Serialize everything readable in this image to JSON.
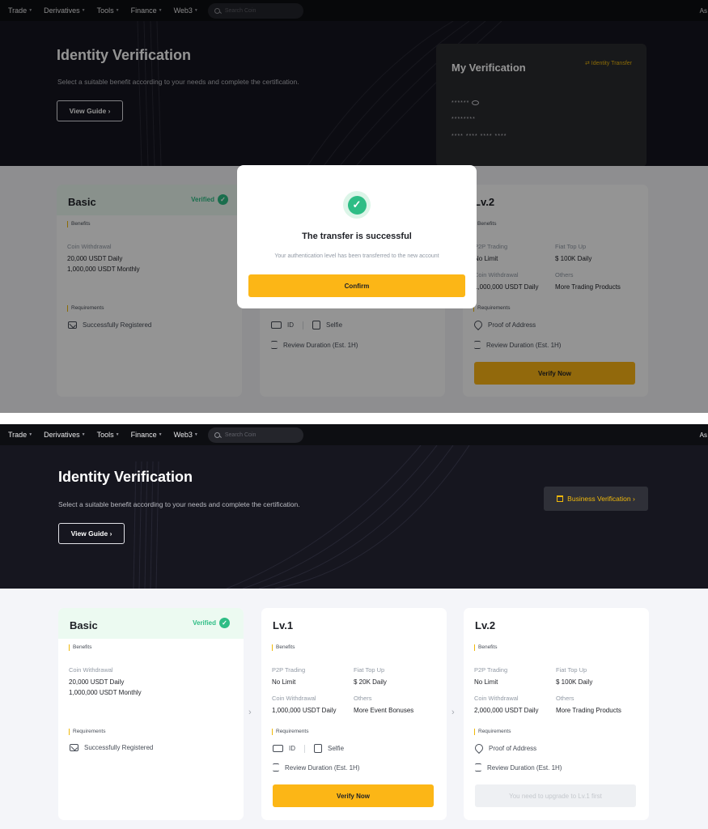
{
  "nav": {
    "items": [
      "Trade",
      "Derivatives",
      "Tools",
      "Finance",
      "Web3"
    ],
    "search_placeholder": "Search Coin",
    "right_text": "As"
  },
  "hero": {
    "title": "Identity Verification",
    "subtitle": "Select a suitable benefit according to your needs and complete the certification.",
    "guide_label": "View Guide",
    "business_label": "Business Verification"
  },
  "my_verification": {
    "title": "My Verification",
    "transfer_label": "Identity Transfer",
    "row1": "******",
    "row2": "********",
    "row3": "**** **** **** ****"
  },
  "modal": {
    "title": "The transfer is successful",
    "message": "Your authentication level has been transferred to the new account",
    "confirm_label": "Confirm"
  },
  "cards": {
    "benefits_label": "Benefits",
    "requirements_label": "Requirements",
    "basic": {
      "title": "Basic",
      "verified_label": "Verified",
      "b1_label": "Coin Withdrawal",
      "b1_line1": "20,000 USDT Daily",
      "b1_line2": "1,000,000 USDT Monthly",
      "req1": "Successfully Registered"
    },
    "lv1": {
      "title": "Lv.1",
      "b1_label": "P2P Trading",
      "b1_value": "No Limit",
      "b2_label": "Fiat Top Up",
      "b2_value": "$ 20K Daily",
      "b3_label": "Coin Withdrawal",
      "b3_value": "1,000,000 USDT Daily",
      "b4_label": "Others",
      "b4_value": "More Event Bonuses",
      "req_id": "ID",
      "req_selfie": "Selfie",
      "review": "Review Duration (Est. 1H)",
      "button": "Verify Now"
    },
    "lv2": {
      "title": "Lv.2",
      "b1_label": "P2P Trading",
      "b1_value": "No Limit",
      "b2_label": "Fiat Top Up",
      "b2_value": "$ 100K Daily",
      "b3_label": "Coin Withdrawal",
      "b3_value_top": "1,000,000 USDT Daily",
      "b3_value": "2,000,000 USDT Daily",
      "b4_label": "Others",
      "b4_value": "More Trading Products",
      "req_address": "Proof of Address",
      "review": "Review Duration (Est. 1H)",
      "button_top": "Verify Now",
      "button_disabled": "You need to upgrade to Lv.1 first"
    }
  },
  "colors": {
    "accent": "#fcb616",
    "success": "#2ebd85",
    "hero_bg": "#16161f"
  }
}
